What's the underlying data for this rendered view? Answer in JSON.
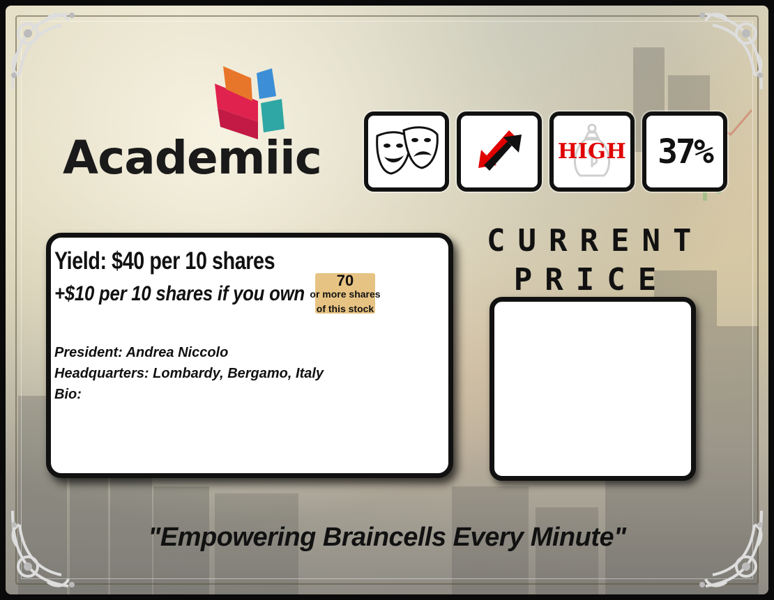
{
  "company": {
    "name": "Academiic",
    "logo_colors": [
      "#e0224f",
      "#e8762a",
      "#3c8fd6",
      "#2fa7a4"
    ]
  },
  "stats": {
    "category_icon": "comedy-tragedy-masks-icon",
    "trend_icon": "red-down-black-up-arrows-icon",
    "risk_label": "HIGH",
    "risk_icon": "money-bag-icon",
    "percentage": "37%"
  },
  "info": {
    "yield": "Yield: $40 per 10 shares",
    "bonus": "+$10 per 10 shares if you own",
    "threshold_number": "70",
    "threshold_line1": "or more shares",
    "threshold_line2": "of this stock",
    "president": "President: Andrea Niccolo",
    "headquarters": "Headquarters: Lombardy, Bergamo, Italy",
    "bio": "Bio:"
  },
  "price": {
    "title_line1": "CURRENT",
    "title_line2": "PRICE",
    "value": ""
  },
  "slogan": "\"Empowering Braincells Every Minute\"",
  "colors": {
    "accent_red": "#e00000",
    "panel": "#ffffff",
    "border": "#111111",
    "threshold_bg": "#e7c383"
  }
}
